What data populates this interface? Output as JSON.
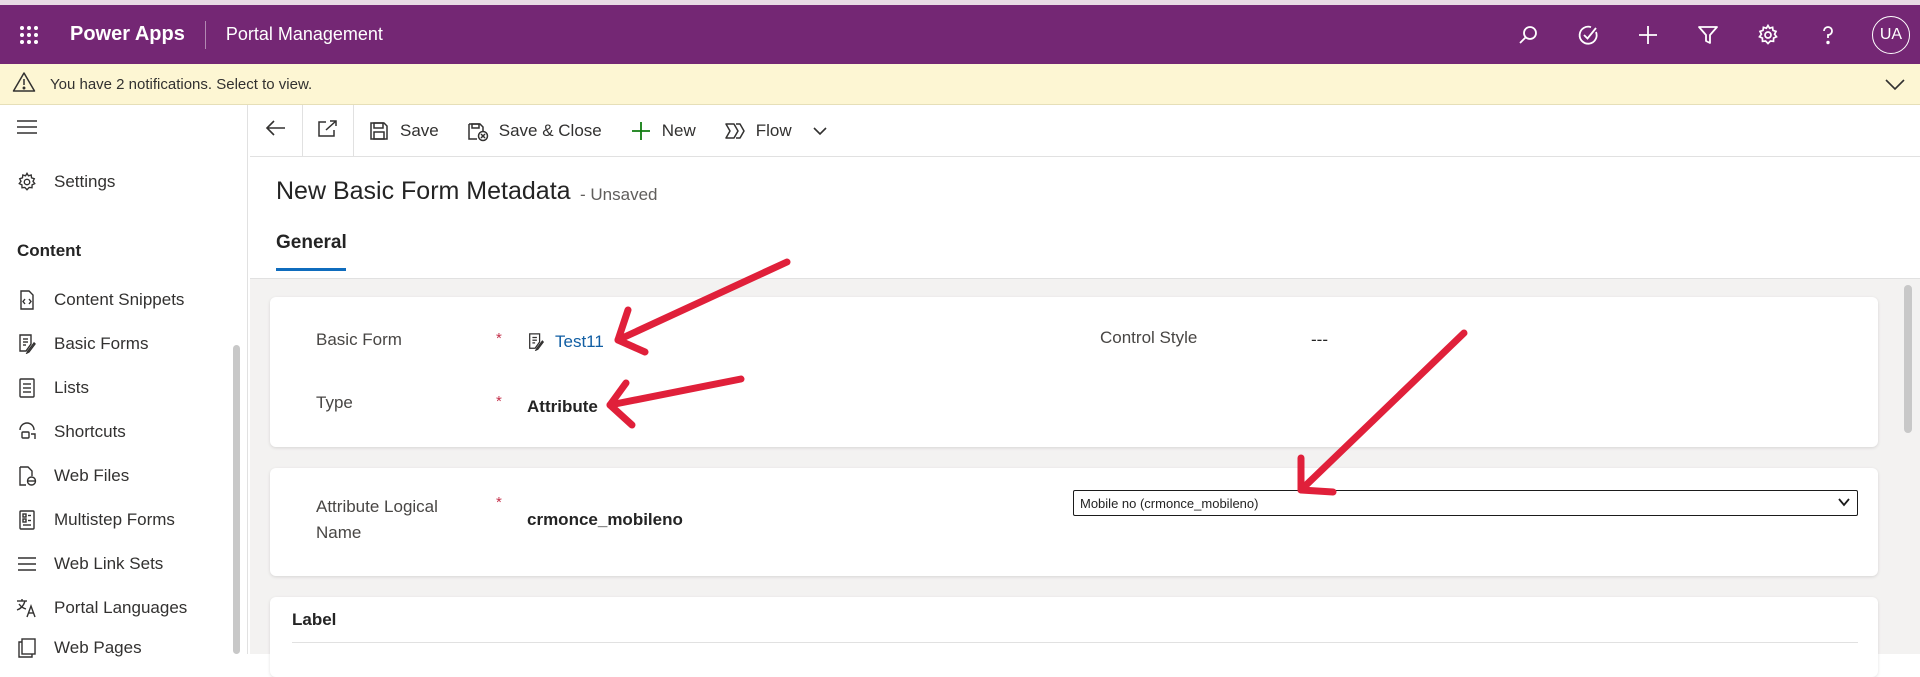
{
  "header": {
    "app_name": "Power Apps",
    "app_subtitle": "Portal Management",
    "avatar_initials": "UA",
    "bg_color": "#742774"
  },
  "notification": {
    "text": "You have 2 notifications. Select to view."
  },
  "sidebar": {
    "settings_label": "Settings",
    "group_label": "Content",
    "items": [
      {
        "label": "Content Snippets",
        "icon": "content-snippet-icon"
      },
      {
        "label": "Basic Forms",
        "icon": "form-icon"
      },
      {
        "label": "Lists",
        "icon": "list-icon"
      },
      {
        "label": "Shortcuts",
        "icon": "shortcut-icon"
      },
      {
        "label": "Web Files",
        "icon": "file-icon"
      },
      {
        "label": "Multistep Forms",
        "icon": "multistep-form-icon"
      },
      {
        "label": "Web Link Sets",
        "icon": "link-set-icon"
      },
      {
        "label": "Portal Languages",
        "icon": "language-icon"
      },
      {
        "label": "Web Pages",
        "icon": "web-page-icon"
      }
    ]
  },
  "commandbar": {
    "save": "Save",
    "save_close": "Save & Close",
    "new": "New",
    "flow": "Flow"
  },
  "form": {
    "title": "New Basic Form Metadata",
    "status": "- Unsaved",
    "tab": "General",
    "basic_form_label": "Basic Form",
    "basic_form_value": "Test11",
    "type_label": "Type",
    "type_value": "Attribute",
    "control_style_label": "Control Style",
    "control_style_value": "---",
    "attr_label_line1": "Attribute Logical",
    "attr_label_line2": "Name",
    "attr_value": "crmonce_mobileno",
    "attr_select": "Mobile no (crmonce_mobileno)",
    "label_section": "Label",
    "required_mark": "*"
  },
  "annotation_color": "#e0203a"
}
